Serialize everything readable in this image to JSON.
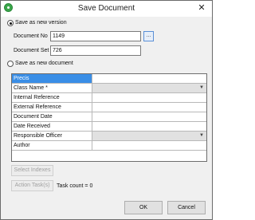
{
  "window": {
    "title": "Save Document",
    "close_glyph": "✕"
  },
  "options": {
    "new_version_label": "Save as new version",
    "new_document_label": "Save as new document",
    "selected": "new_version"
  },
  "fields": {
    "document_no_label": "Document No",
    "document_no_value": "1149",
    "browse_label": "...",
    "document_set_label": "Document Set",
    "document_set_value": "726"
  },
  "grid": {
    "rows": [
      {
        "label": "Precis",
        "value": "",
        "type": "text",
        "selected": true
      },
      {
        "label": "Class Name *",
        "value": "",
        "type": "combo"
      },
      {
        "label": "Internal Reference",
        "value": "",
        "type": "text"
      },
      {
        "label": "External Reference",
        "value": "",
        "type": "text"
      },
      {
        "label": "Document Date",
        "value": "",
        "type": "text"
      },
      {
        "label": "Date Received",
        "value": "",
        "type": "text"
      },
      {
        "label": "Responsible Officer",
        "value": "",
        "type": "combo"
      },
      {
        "label": "Author",
        "value": "",
        "type": "text"
      }
    ]
  },
  "actions": {
    "select_indexes": "Select Indexes",
    "action_tasks": "Action Task(s)",
    "task_count": "Task count = 0"
  },
  "footer": {
    "ok": "OK",
    "cancel": "Cancel"
  },
  "colors": {
    "selection": "#3a8ee6",
    "app_icon": "#3aa64a"
  }
}
